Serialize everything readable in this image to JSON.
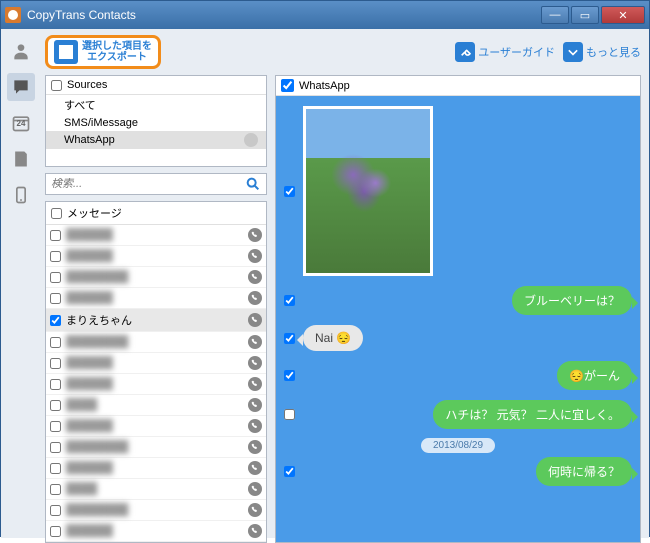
{
  "window": {
    "title": "CopyTrans Contacts"
  },
  "toolbar": {
    "export_line1": "選択した項目を",
    "export_line2": "エクスポート",
    "user_guide": "ユーザーガイド",
    "more": "もっと見る"
  },
  "sidebar": {
    "calendar_day": "24"
  },
  "sources": {
    "header": "Sources",
    "items": [
      {
        "label": "すべて",
        "selected": false,
        "badge": false
      },
      {
        "label": "SMS/iMessage",
        "selected": false,
        "badge": false
      },
      {
        "label": "WhatsApp",
        "selected": true,
        "badge": true
      }
    ]
  },
  "search": {
    "placeholder": "検索..."
  },
  "messages": {
    "header": "メッセージ",
    "items": [
      {
        "label": "██████",
        "checked": false,
        "selected": false,
        "blur": true
      },
      {
        "label": "██████",
        "checked": false,
        "selected": false,
        "blur": true
      },
      {
        "label": "████████",
        "checked": false,
        "selected": false,
        "blur": true
      },
      {
        "label": "██████",
        "checked": false,
        "selected": false,
        "blur": true
      },
      {
        "label": "まりえちゃん",
        "checked": true,
        "selected": true,
        "blur": false
      },
      {
        "label": "████████",
        "checked": false,
        "selected": false,
        "blur": true
      },
      {
        "label": "██████",
        "checked": false,
        "selected": false,
        "blur": true
      },
      {
        "label": "██████",
        "checked": false,
        "selected": false,
        "blur": true
      },
      {
        "label": "████",
        "checked": false,
        "selected": false,
        "blur": true
      },
      {
        "label": "██████",
        "checked": false,
        "selected": false,
        "blur": true
      },
      {
        "label": "████████",
        "checked": false,
        "selected": false,
        "blur": true
      },
      {
        "label": "██████",
        "checked": false,
        "selected": false,
        "blur": true
      },
      {
        "label": "████",
        "checked": false,
        "selected": false,
        "blur": true
      },
      {
        "label": "████████",
        "checked": false,
        "selected": false,
        "blur": true
      },
      {
        "label": "██████",
        "checked": false,
        "selected": false,
        "blur": true
      }
    ]
  },
  "conversation": {
    "header": "WhatsApp",
    "rows": [
      {
        "type": "photo",
        "side": "left",
        "checked": true
      },
      {
        "type": "bubble",
        "side": "right",
        "style": "green",
        "text": "ブルーベリーは？",
        "checked": true
      },
      {
        "type": "bubble",
        "side": "left",
        "style": "gray",
        "text": "Nai 😔",
        "checked": true
      },
      {
        "type": "bubble",
        "side": "right",
        "style": "green",
        "text": "😔がーん",
        "checked": true
      },
      {
        "type": "bubble",
        "side": "right",
        "style": "green",
        "text": "ハチは？ 元気？ 二人に宜しく。",
        "checked": false
      },
      {
        "type": "date",
        "text": "2013/08/29"
      },
      {
        "type": "bubble",
        "side": "right",
        "style": "green",
        "text": "何時に帰る？",
        "checked": true
      }
    ]
  }
}
